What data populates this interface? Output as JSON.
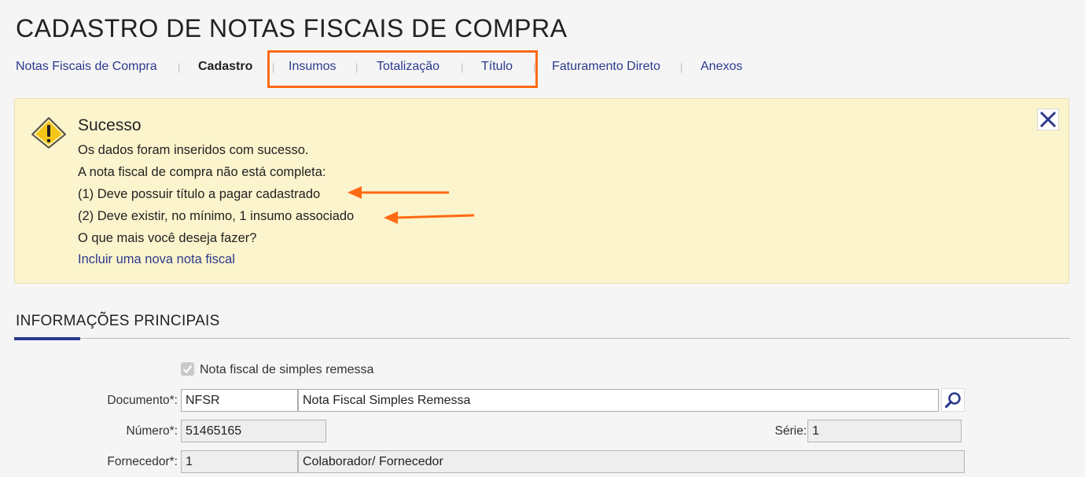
{
  "page": {
    "title": "CADASTRO DE NOTAS FISCAIS DE COMPRA"
  },
  "tabs": [
    {
      "label": "Notas Fiscais de Compra"
    },
    {
      "label": "Cadastro"
    },
    {
      "label": "Insumos"
    },
    {
      "label": "Totalização"
    },
    {
      "label": "Título"
    },
    {
      "label": "Faturamento Direto"
    },
    {
      "label": "Anexos"
    }
  ],
  "alert": {
    "title": "Sucesso",
    "lines": [
      "Os dados foram inseridos com sucesso.",
      "A nota fiscal de compra não está completa:",
      "(1) Deve possuir título a pagar cadastrado",
      "(2) Deve existir, no mínimo, 1 insumo associado",
      "O que mais você deseja fazer?"
    ],
    "link": "Incluir uma nova nota fiscal",
    "icon": "warning-icon",
    "close_icon": "close-icon"
  },
  "section": {
    "title": "INFORMAÇÕES PRINCIPAIS"
  },
  "form": {
    "simples_remessa": {
      "label": "Nota fiscal de simples remessa",
      "checked": true
    },
    "documento": {
      "label": "Documento*:",
      "code": "NFSR",
      "description": "Nota Fiscal Simples Remessa"
    },
    "numero": {
      "label": "Número*:",
      "value": "51465165"
    },
    "serie": {
      "label": "Série:",
      "value": "1"
    },
    "fornecedor": {
      "label": "Fornecedor*:",
      "code": "1",
      "name": "Colaborador/ Fornecedor"
    }
  },
  "colors": {
    "accent": "#2b3a8c",
    "annotation": "#ff6a13",
    "alert_background": "#fcf4cd"
  }
}
